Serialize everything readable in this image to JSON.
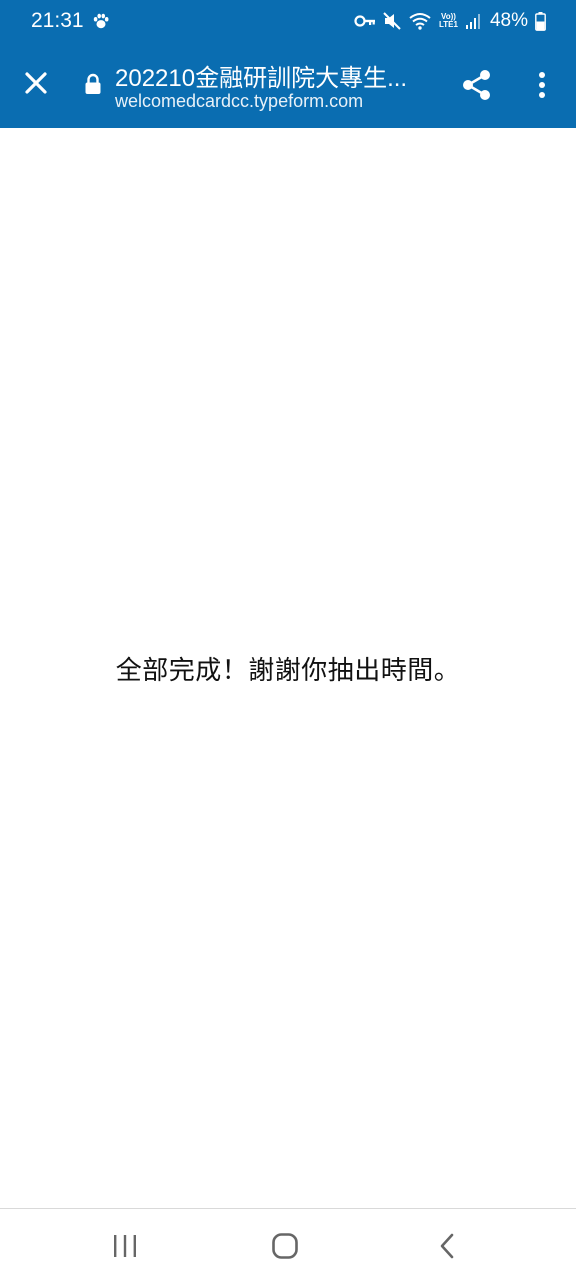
{
  "status_bar": {
    "time": "21:31",
    "battery_percent": "48%",
    "network_label_top": "Vo))",
    "network_label_bottom": "LTE1",
    "icons": [
      "paw-icon",
      "key-icon",
      "mute-icon",
      "wifi-icon",
      "signal-icon",
      "battery-icon"
    ]
  },
  "browser_bar": {
    "title": "202210金融研訓院大專生...",
    "url": "welcomedcardcc.typeform.com",
    "color": "#0a6db1",
    "icons": [
      "close-icon",
      "lock-icon",
      "share-icon",
      "more-vert-icon"
    ]
  },
  "content": {
    "message": "全部完成！謝謝你抽出時間。"
  },
  "nav_bar": {
    "icons": [
      "recents-icon",
      "home-icon",
      "back-icon"
    ]
  }
}
